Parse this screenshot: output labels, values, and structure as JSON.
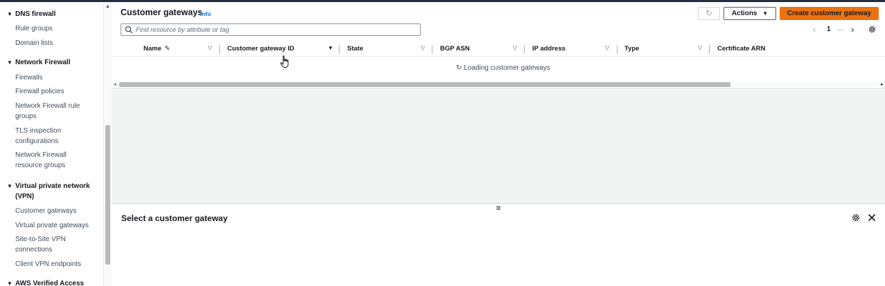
{
  "sidebar": {
    "sections": [
      {
        "title": "DNS firewall",
        "items": [
          "Rule groups",
          "Domain lists"
        ]
      },
      {
        "title": "Network Firewall",
        "items": [
          "Firewalls",
          "Firewall policies",
          "Network Firewall rule groups",
          "TLS inspection configurations",
          "Network Firewall resource groups"
        ]
      },
      {
        "title": "Virtual private network (VPN)",
        "items": [
          "Customer gateways",
          "Virtual private gateways",
          "Site-to-Site VPN connections",
          "Client VPN endpoints"
        ]
      },
      {
        "title": "AWS Verified Access"
      }
    ]
  },
  "header": {
    "title": "Customer gateways",
    "info": "info",
    "actions_label": "Actions",
    "create_label": "Create customer gateway"
  },
  "search": {
    "placeholder": "Find resource by attribute or tag",
    "value": ""
  },
  "pagination": {
    "page": "1",
    "ellipsis": "..."
  },
  "table": {
    "columns": [
      "Name",
      "Customer gateway ID",
      "State",
      "BGP ASN",
      "IP address",
      "Type",
      "Certificate ARN"
    ],
    "loading_text": "Loading customer gateways"
  },
  "split_panel": {
    "title": "Select a customer gateway",
    "handle": "="
  },
  "colors": {
    "primary_button": "#ec7211",
    "link": "#0972d3",
    "empty_background": "#f2f3f3"
  }
}
